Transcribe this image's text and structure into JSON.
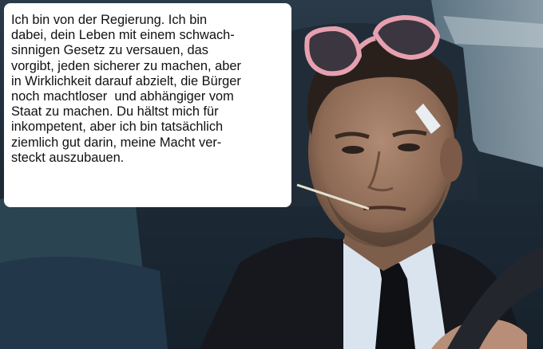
{
  "speech_bubble": {
    "lines": [
      "Ich bin von der Regierung. Ich bin",
      "dabei, dein Leben mit einem schwach-",
      "sinnigen Gesetz zu versauen, das",
      "vorgibt, jeden sicherer zu machen, aber",
      "in Wirklichkeit darauf abzielt, die Bürger",
      "noch machtloser  und abhängiger vom",
      "Staat zu machen. Du hältst mich für",
      "inkompetent, aber ich bin tatsächlich",
      "ziemlich gut darin, meine Macht ver-",
      "steckt auszubauen."
    ]
  },
  "colors": {
    "bubble_bg": "#ffffff",
    "car_interior": "#1b2a36",
    "suit": "#16181d",
    "shirt": "#d9e4ee",
    "skin": "#9a7560",
    "sunglasses_frame": "#e7a0b0"
  }
}
